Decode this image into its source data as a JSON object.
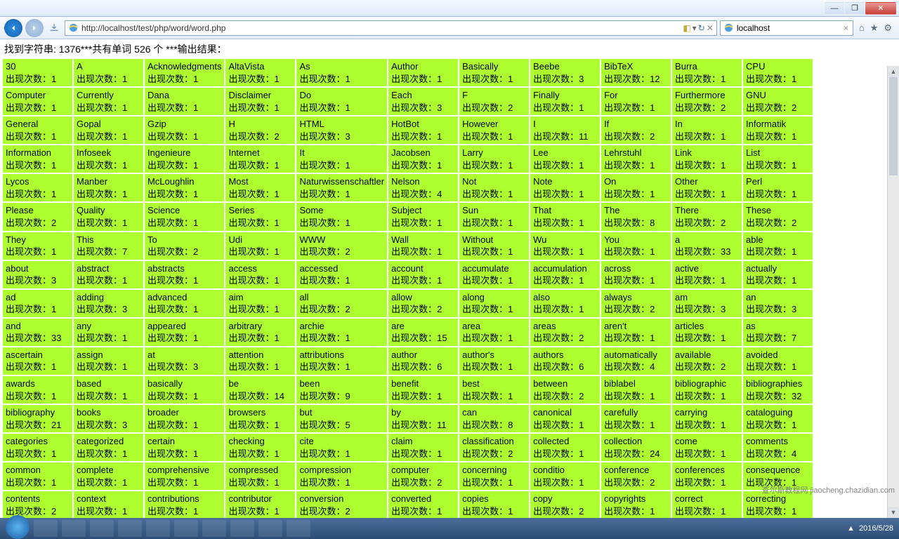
{
  "window": {
    "close": "✕",
    "max": "❐",
    "min": "—"
  },
  "nav": {
    "url": "http://localhost/test/php/word/word.php",
    "tab_title": "localhost"
  },
  "summary": "找到字符串: 1376***共有单词 526 个 ***输出结果：",
  "count_label_prefix": "出现次数：",
  "words": [
    {
      "w": "30",
      "c": 1
    },
    {
      "w": "A",
      "c": 1
    },
    {
      "w": "Acknowledgments",
      "c": 1
    },
    {
      "w": "AltaVista",
      "c": 1
    },
    {
      "w": "As",
      "c": 1
    },
    {
      "w": "Author",
      "c": 1
    },
    {
      "w": "Basically",
      "c": 1
    },
    {
      "w": "Beebe",
      "c": 3
    },
    {
      "w": "BibTeX",
      "c": 12
    },
    {
      "w": "Burra",
      "c": 1
    },
    {
      "w": "CPU",
      "c": 1
    },
    {
      "w": "Computer",
      "c": 1
    },
    {
      "w": "Currently",
      "c": 1
    },
    {
      "w": "Dana",
      "c": 1
    },
    {
      "w": "Disclaimer",
      "c": 1
    },
    {
      "w": "Do",
      "c": 1
    },
    {
      "w": "Each",
      "c": 3
    },
    {
      "w": "F",
      "c": 2
    },
    {
      "w": "Finally",
      "c": 1
    },
    {
      "w": "For",
      "c": 1
    },
    {
      "w": "Furthermore",
      "c": 2
    },
    {
      "w": "GNU",
      "c": 2
    },
    {
      "w": "General",
      "c": 1
    },
    {
      "w": "Gopal",
      "c": 1
    },
    {
      "w": "Gzip",
      "c": 1
    },
    {
      "w": "H",
      "c": 2
    },
    {
      "w": "HTML",
      "c": 3
    },
    {
      "w": "HotBot",
      "c": 1
    },
    {
      "w": "However",
      "c": 1
    },
    {
      "w": "I",
      "c": 11
    },
    {
      "w": "If",
      "c": 2
    },
    {
      "w": "In",
      "c": 1
    },
    {
      "w": "Informatik",
      "c": 1
    },
    {
      "w": "Information",
      "c": 1
    },
    {
      "w": "Infoseek",
      "c": 1
    },
    {
      "w": "Ingenieure",
      "c": 1
    },
    {
      "w": "Internet",
      "c": 1
    },
    {
      "w": "It",
      "c": 1
    },
    {
      "w": "Jacobsen",
      "c": 1
    },
    {
      "w": "Larry",
      "c": 1
    },
    {
      "w": "Lee",
      "c": 1
    },
    {
      "w": "Lehrstuhl",
      "c": 1
    },
    {
      "w": "Link",
      "c": 1
    },
    {
      "w": "List",
      "c": 1
    },
    {
      "w": "Lycos",
      "c": 1
    },
    {
      "w": "Manber",
      "c": 1
    },
    {
      "w": "McLoughlin",
      "c": 1
    },
    {
      "w": "Most",
      "c": 1
    },
    {
      "w": "Naturwissenschaftler",
      "c": 1
    },
    {
      "w": "Nelson",
      "c": 4
    },
    {
      "w": "Not",
      "c": 1
    },
    {
      "w": "Note",
      "c": 1
    },
    {
      "w": "On",
      "c": 1
    },
    {
      "w": "Other",
      "c": 1
    },
    {
      "w": "Perl",
      "c": 1
    },
    {
      "w": "Please",
      "c": 2
    },
    {
      "w": "Quality",
      "c": 1
    },
    {
      "w": "Science",
      "c": 1
    },
    {
      "w": "Series",
      "c": 1
    },
    {
      "w": "Some",
      "c": 1
    },
    {
      "w": "Subject",
      "c": 1
    },
    {
      "w": "Sun",
      "c": 1
    },
    {
      "w": "That",
      "c": 1
    },
    {
      "w": "The",
      "c": 8
    },
    {
      "w": "There",
      "c": 2
    },
    {
      "w": "These",
      "c": 2
    },
    {
      "w": "They",
      "c": 1
    },
    {
      "w": "This",
      "c": 7
    },
    {
      "w": "To",
      "c": 2
    },
    {
      "w": "Udi",
      "c": 1
    },
    {
      "w": "WWW",
      "c": 2
    },
    {
      "w": "Wall",
      "c": 1
    },
    {
      "w": "Without",
      "c": 1
    },
    {
      "w": "Wu",
      "c": 1
    },
    {
      "w": "You",
      "c": 1
    },
    {
      "w": "a",
      "c": 33
    },
    {
      "w": "able",
      "c": 1
    },
    {
      "w": "about",
      "c": 3
    },
    {
      "w": "abstract",
      "c": 1
    },
    {
      "w": "abstracts",
      "c": 1
    },
    {
      "w": "access",
      "c": 1
    },
    {
      "w": "accessed",
      "c": 1
    },
    {
      "w": "account",
      "c": 1
    },
    {
      "w": "accumulate",
      "c": 1
    },
    {
      "w": "accumulation",
      "c": 1
    },
    {
      "w": "across",
      "c": 1
    },
    {
      "w": "active",
      "c": 1
    },
    {
      "w": "actually",
      "c": 1
    },
    {
      "w": "ad",
      "c": 1
    },
    {
      "w": "adding",
      "c": 3
    },
    {
      "w": "advanced",
      "c": 1
    },
    {
      "w": "aim",
      "c": 1
    },
    {
      "w": "all",
      "c": 2
    },
    {
      "w": "allow",
      "c": 2
    },
    {
      "w": "along",
      "c": 1
    },
    {
      "w": "also",
      "c": 1
    },
    {
      "w": "always",
      "c": 2
    },
    {
      "w": "am",
      "c": 3
    },
    {
      "w": "an",
      "c": 3
    },
    {
      "w": "and",
      "c": 33
    },
    {
      "w": "any",
      "c": 1
    },
    {
      "w": "appeared",
      "c": 1
    },
    {
      "w": "arbitrary",
      "c": 1
    },
    {
      "w": "archie",
      "c": 1
    },
    {
      "w": "are",
      "c": 15
    },
    {
      "w": "area",
      "c": 1
    },
    {
      "w": "areas",
      "c": 2
    },
    {
      "w": "aren't",
      "c": 1
    },
    {
      "w": "articles",
      "c": 1
    },
    {
      "w": "as",
      "c": 7
    },
    {
      "w": "ascertain",
      "c": 1
    },
    {
      "w": "assign",
      "c": 1
    },
    {
      "w": "at",
      "c": 3
    },
    {
      "w": "attention",
      "c": 1
    },
    {
      "w": "attributions",
      "c": 1
    },
    {
      "w": "author",
      "c": 6
    },
    {
      "w": "author's",
      "c": 1
    },
    {
      "w": "authors",
      "c": 6
    },
    {
      "w": "automatically",
      "c": 4
    },
    {
      "w": "available",
      "c": 2
    },
    {
      "w": "avoided",
      "c": 1
    },
    {
      "w": "awards",
      "c": 1
    },
    {
      "w": "based",
      "c": 1
    },
    {
      "w": "basically",
      "c": 1
    },
    {
      "w": "be",
      "c": 14
    },
    {
      "w": "been",
      "c": 9
    },
    {
      "w": "benefit",
      "c": 1
    },
    {
      "w": "best",
      "c": 1
    },
    {
      "w": "between",
      "c": 2
    },
    {
      "w": "biblabel",
      "c": 1
    },
    {
      "w": "bibliographic",
      "c": 1
    },
    {
      "w": "bibliographies",
      "c": 32
    },
    {
      "w": "bibliography",
      "c": 21
    },
    {
      "w": "books",
      "c": 3
    },
    {
      "w": "broader",
      "c": 1
    },
    {
      "w": "browsers",
      "c": 1
    },
    {
      "w": "but",
      "c": 5
    },
    {
      "w": "by",
      "c": 11
    },
    {
      "w": "can",
      "c": 8
    },
    {
      "w": "canonical",
      "c": 1
    },
    {
      "w": "carefully",
      "c": 1
    },
    {
      "w": "carrying",
      "c": 1
    },
    {
      "w": "cataloguing",
      "c": 1
    },
    {
      "w": "categories",
      "c": 1
    },
    {
      "w": "categorized",
      "c": 1
    },
    {
      "w": "certain",
      "c": 1
    },
    {
      "w": "checking",
      "c": 1
    },
    {
      "w": "cite",
      "c": 1
    },
    {
      "w": "claim",
      "c": 1
    },
    {
      "w": "classification",
      "c": 2
    },
    {
      "w": "collected",
      "c": 1
    },
    {
      "w": "collection",
      "c": 24
    },
    {
      "w": "come",
      "c": 1
    },
    {
      "w": "comments",
      "c": 4
    },
    {
      "w": "common",
      "c": 1
    },
    {
      "w": "complete",
      "c": 1
    },
    {
      "w": "comprehensive",
      "c": 1
    },
    {
      "w": "compressed",
      "c": 1
    },
    {
      "w": "compression",
      "c": 1
    },
    {
      "w": "computer",
      "c": 2
    },
    {
      "w": "concerning",
      "c": 1
    },
    {
      "w": "conditio",
      "c": 1
    },
    {
      "w": "conference",
      "c": 2
    },
    {
      "w": "conferences",
      "c": 1
    },
    {
      "w": "consequence",
      "c": 1
    },
    {
      "w": "contents",
      "c": 2
    },
    {
      "w": "context",
      "c": 1
    },
    {
      "w": "contributions",
      "c": 1
    },
    {
      "w": "contributor",
      "c": 1
    },
    {
      "w": "conversion",
      "c": 2
    },
    {
      "w": "converted",
      "c": 1
    },
    {
      "w": "copies",
      "c": 1
    },
    {
      "w": "copy",
      "c": 2
    },
    {
      "w": "copyrights",
      "c": 1
    },
    {
      "w": "correct",
      "c": 1
    },
    {
      "w": "correcting",
      "c": 1
    }
  ],
  "watermark": "查尔斯教程网 jiaocheng.chazidian.com",
  "taskbar_time": "2016/5/28"
}
